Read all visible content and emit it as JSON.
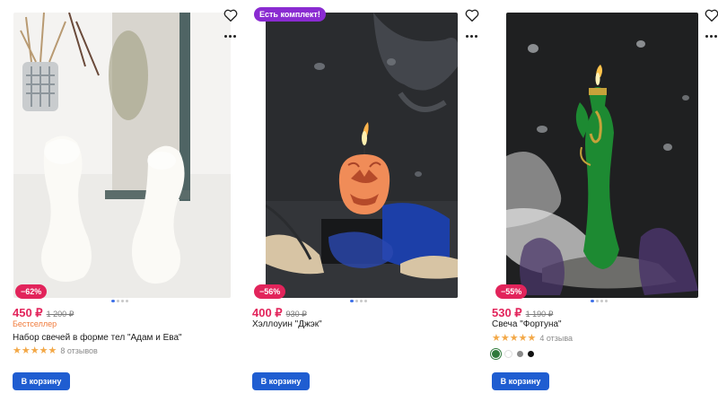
{
  "products": [
    {
      "discount": "−62%",
      "price": "450 ₽",
      "old_price": "1 200 ₽",
      "tag": "Бестселлер",
      "title": "Набор свечей в форме тел \"Адам и Ева\"",
      "stars": "★★★★★",
      "reviews": "8 отзывов",
      "cart_label": "В корзину"
    },
    {
      "badge": "Есть комплект!",
      "discount": "−56%",
      "price": "400 ₽",
      "old_price": "930 ₽",
      "title": "Хэллоуин \"Джэк\"",
      "cart_label": "В корзину"
    },
    {
      "discount": "−55%",
      "price": "530 ₽",
      "old_price": "1 190 ₽",
      "title": "Свеча \"Фортуна\"",
      "stars": "★★★★★",
      "reviews": "4 отзыва",
      "colors": [
        "#2f7a3a",
        "#ffffff",
        "#8a8a8a",
        "#111111"
      ],
      "cart_label": "В корзину"
    }
  ],
  "icons": {
    "favorite": "heart-outline-icon",
    "more": "more-horizontal-icon"
  },
  "colors": {
    "accent": "#1f5dd1",
    "sale": "#e2245b",
    "kit_badge": "#8a2bd1",
    "stars": "#f3a847",
    "tag": "#f07a3a"
  },
  "carousel": {
    "slides": 4,
    "active": 1
  }
}
